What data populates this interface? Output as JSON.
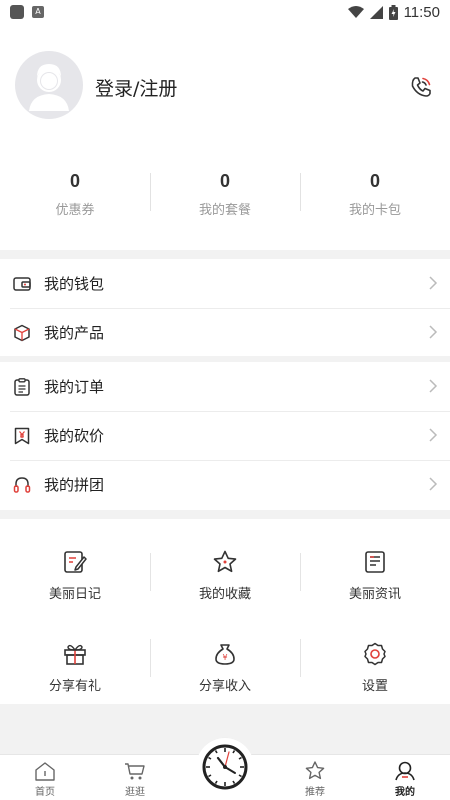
{
  "status_bar": {
    "time": "11:50"
  },
  "profile": {
    "login_label": "登录/注册"
  },
  "stats": [
    {
      "value": "0",
      "label": "优惠券"
    },
    {
      "value": "0",
      "label": "我的套餐"
    },
    {
      "value": "0",
      "label": "我的卡包"
    }
  ],
  "menu_group_1": [
    {
      "label": "我的钱包",
      "icon": "wallet-icon"
    },
    {
      "label": "我的产品",
      "icon": "box-icon"
    }
  ],
  "menu_group_2": [
    {
      "label": "我的订单",
      "icon": "clipboard-icon"
    },
    {
      "label": "我的砍价",
      "icon": "price-tag-icon"
    },
    {
      "label": "我的拼团",
      "icon": "headset-icon"
    }
  ],
  "grid": [
    {
      "label": "美丽日记",
      "icon": "diary-icon"
    },
    {
      "label": "我的收藏",
      "icon": "star-icon"
    },
    {
      "label": "美丽资讯",
      "icon": "news-icon"
    },
    {
      "label": "分享有礼",
      "icon": "gift-icon"
    },
    {
      "label": "分享收入",
      "icon": "money-bag-icon"
    },
    {
      "label": "设置",
      "icon": "settings-icon"
    }
  ],
  "tabbar": [
    {
      "label": "首页",
      "icon": "home-icon"
    },
    {
      "label": "逛逛",
      "icon": "cart-icon"
    },
    {
      "label": "推荐",
      "icon": "star-icon"
    },
    {
      "label": "我的",
      "icon": "user-icon",
      "active": true
    }
  ],
  "colors": {
    "accent": "#e0403a",
    "background": "#f2f2f2"
  }
}
